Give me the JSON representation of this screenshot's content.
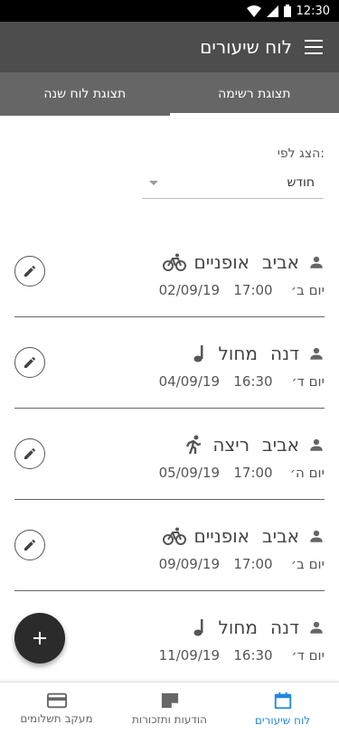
{
  "status_bar": {
    "time": "12:30"
  },
  "app_bar": {
    "title": "לוח שיעורים"
  },
  "tabs": [
    {
      "label": "תצוגת רשימה",
      "active": true
    },
    {
      "label": "תצוגת לוח שנה",
      "active": false
    }
  ],
  "filter": {
    "label": "הצג לפי:",
    "value": "חודש"
  },
  "lessons": [
    {
      "teacher": "אביב",
      "activity": "אופניים",
      "activity_icon": "bike-icon",
      "day": "יום ב׳",
      "time": "17:00",
      "date": "02/09/19"
    },
    {
      "teacher": "דנה",
      "activity": "מחול",
      "activity_icon": "music-note-icon",
      "day": "יום ד׳",
      "time": "16:30",
      "date": "04/09/19"
    },
    {
      "teacher": "אביב",
      "activity": "ריצה",
      "activity_icon": "running-icon",
      "day": "יום ה׳",
      "time": "17:00",
      "date": "05/09/19"
    },
    {
      "teacher": "אביב",
      "activity": "אופניים",
      "activity_icon": "bike-icon",
      "day": "יום ב׳",
      "time": "17:00",
      "date": "09/09/19"
    },
    {
      "teacher": "דנה",
      "activity": "מחול",
      "activity_icon": "music-note-icon",
      "day": "יום ד׳",
      "time": "16:30",
      "date": "11/09/19"
    }
  ],
  "fab": {
    "icon": "plus-icon"
  },
  "bottom_nav": [
    {
      "label": "לוח שיעורים",
      "icon": "calendar-icon",
      "active": true
    },
    {
      "label": "הודעות ותזכורות",
      "icon": "note-icon",
      "active": false
    },
    {
      "label": "מעקב תשלומים",
      "icon": "credit-card-icon",
      "active": false
    }
  ],
  "colors": {
    "app_bar": "#4d4d4d",
    "tabs": "#666666",
    "accent": "#1e88e5",
    "fab": "#2b2b2b"
  }
}
